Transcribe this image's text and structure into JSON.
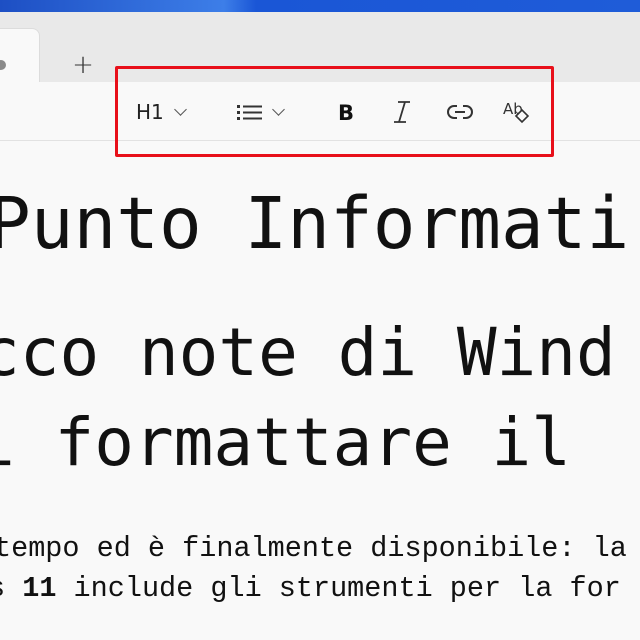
{
  "tabs": {
    "new_tab_label": "+"
  },
  "toolbar": {
    "heading_label": "H1",
    "icons": [
      "list-icon",
      "bold-icon",
      "italic-icon",
      "link-icon",
      "clear-formatting-icon"
    ]
  },
  "content": {
    "heading1": "Punto Informati",
    "heading2_line1": "cco note di Wind",
    "heading2_line2": "i formattare il",
    "para_line1": "tempo ed è finalmente disponibile: la",
    "para_line2_prefix": "s ",
    "para_line2_bold": "11",
    "para_line2_rest": " include gli strumenti per la for"
  },
  "colors": {
    "highlight": "#e8101a",
    "accent": "#1f5cd8"
  }
}
